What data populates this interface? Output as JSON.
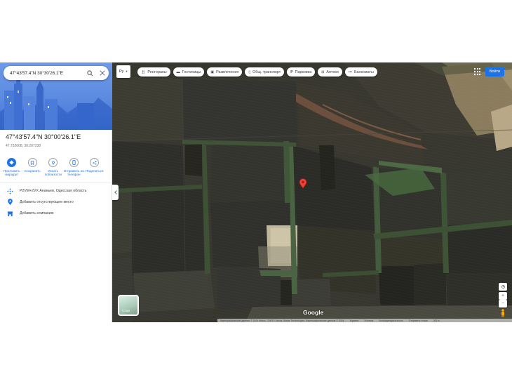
{
  "search": {
    "query": "47°43'57.4\"N 30°30'26.1\"E"
  },
  "place": {
    "title": "47°43'57.4\"N 30°00'26.1\"E",
    "coords": "47.732608, 30.207238"
  },
  "actions": [
    {
      "label": "Проложить маршрут",
      "icon": "directions-icon"
    },
    {
      "label": "Сохранить",
      "icon": "bookmark-icon"
    },
    {
      "label": "Искать поблизости",
      "icon": "nearby-icon"
    },
    {
      "label": "Отправить на телефон",
      "icon": "phone-icon"
    },
    {
      "label": "Поделиться",
      "icon": "share-icon"
    }
  ],
  "info": {
    "plus_code": "P2VM+2VX Ананьев, Одесская область",
    "add_missing_place": "Добавить отсутствующее место",
    "add_business": "Добавить компанию"
  },
  "map": {
    "language": "Ру",
    "chips": [
      {
        "label": "Рестораны",
        "icon": "restaurant-icon"
      },
      {
        "label": "Гостиницы",
        "icon": "hotel-icon"
      },
      {
        "label": "Развлечения",
        "icon": "ticket-icon"
      },
      {
        "label": "Общ. транспорт",
        "icon": "transit-icon"
      },
      {
        "label": "Парковка",
        "icon": "parking-icon"
      },
      {
        "label": "Аптеки",
        "icon": "pharmacy-icon"
      },
      {
        "label": "Банкоматы",
        "icon": "more-icon"
      }
    ],
    "signin": "Войти",
    "layers_label": "Слои",
    "google_logo": "Google",
    "attribution": [
      "Картографические данные © 2024 Airbus, CNES / Airbus, Maxar Technologies, Картографические данные © 2024",
      "Украина",
      "Условия",
      "Конфиденциальность",
      "Отправить отзыв",
      "200 м"
    ]
  }
}
